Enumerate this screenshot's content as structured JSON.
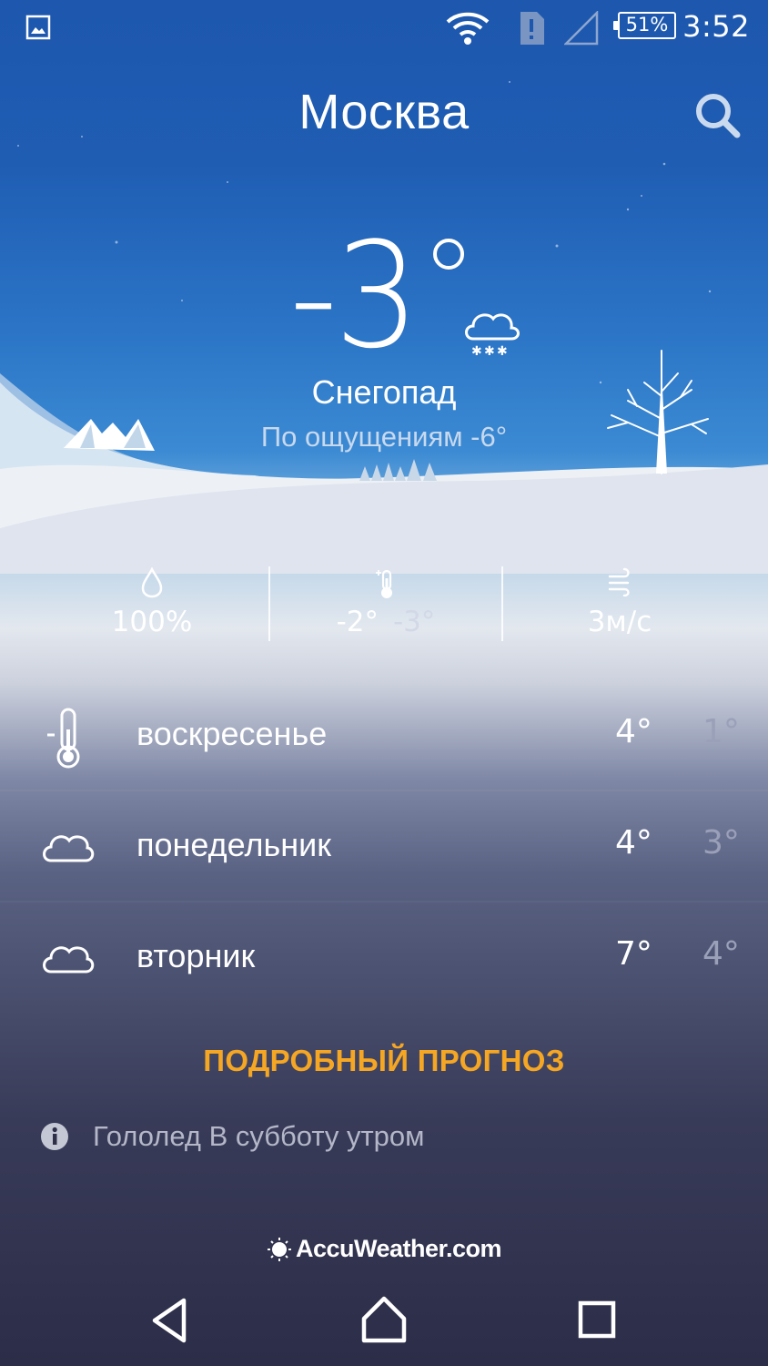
{
  "status_bar": {
    "time": "3:52",
    "battery": "51%",
    "icons": [
      "gallery-icon",
      "wifi-icon",
      "sim-alert-icon",
      "signal-icon",
      "battery-icon"
    ]
  },
  "header": {
    "city": "Москва",
    "search_icon": "search-icon"
  },
  "current": {
    "temperature": "-3",
    "condition": "Снегопад",
    "feels_like": "По ощущениям -6°",
    "condition_icon": "snow-cloud-icon"
  },
  "stats": {
    "humidity": {
      "icon": "drop-icon",
      "value": "100%"
    },
    "temperature_range": {
      "icon": "thermometer-icon",
      "high": "-2°",
      "low": "-3°"
    },
    "wind": {
      "icon": "wind-icon",
      "value": "3м/с"
    }
  },
  "forecast": [
    {
      "day": "воскресенье",
      "icon": "thermometer-icon",
      "high": "4°",
      "low": "1°"
    },
    {
      "day": "понедельник",
      "icon": "cloud-icon",
      "high": "4°",
      "low": "3°"
    },
    {
      "day": "вторник",
      "icon": "cloud-icon",
      "high": "7°",
      "low": "4°"
    }
  ],
  "detail_link": "ПОДРОБНЫЙ ПРОГНОЗ",
  "alert": {
    "icon": "info-icon",
    "text": "Гололед В субботу утром"
  },
  "brand": {
    "text": "AccuWeather.com",
    "icon": "sun-logo-icon"
  },
  "colors": {
    "accent": "#f5a623",
    "sky_top": "#1d57ae",
    "bottom": "#2c2d48"
  },
  "navbar": {
    "icons": [
      "back-icon",
      "home-icon",
      "recents-icon"
    ]
  }
}
